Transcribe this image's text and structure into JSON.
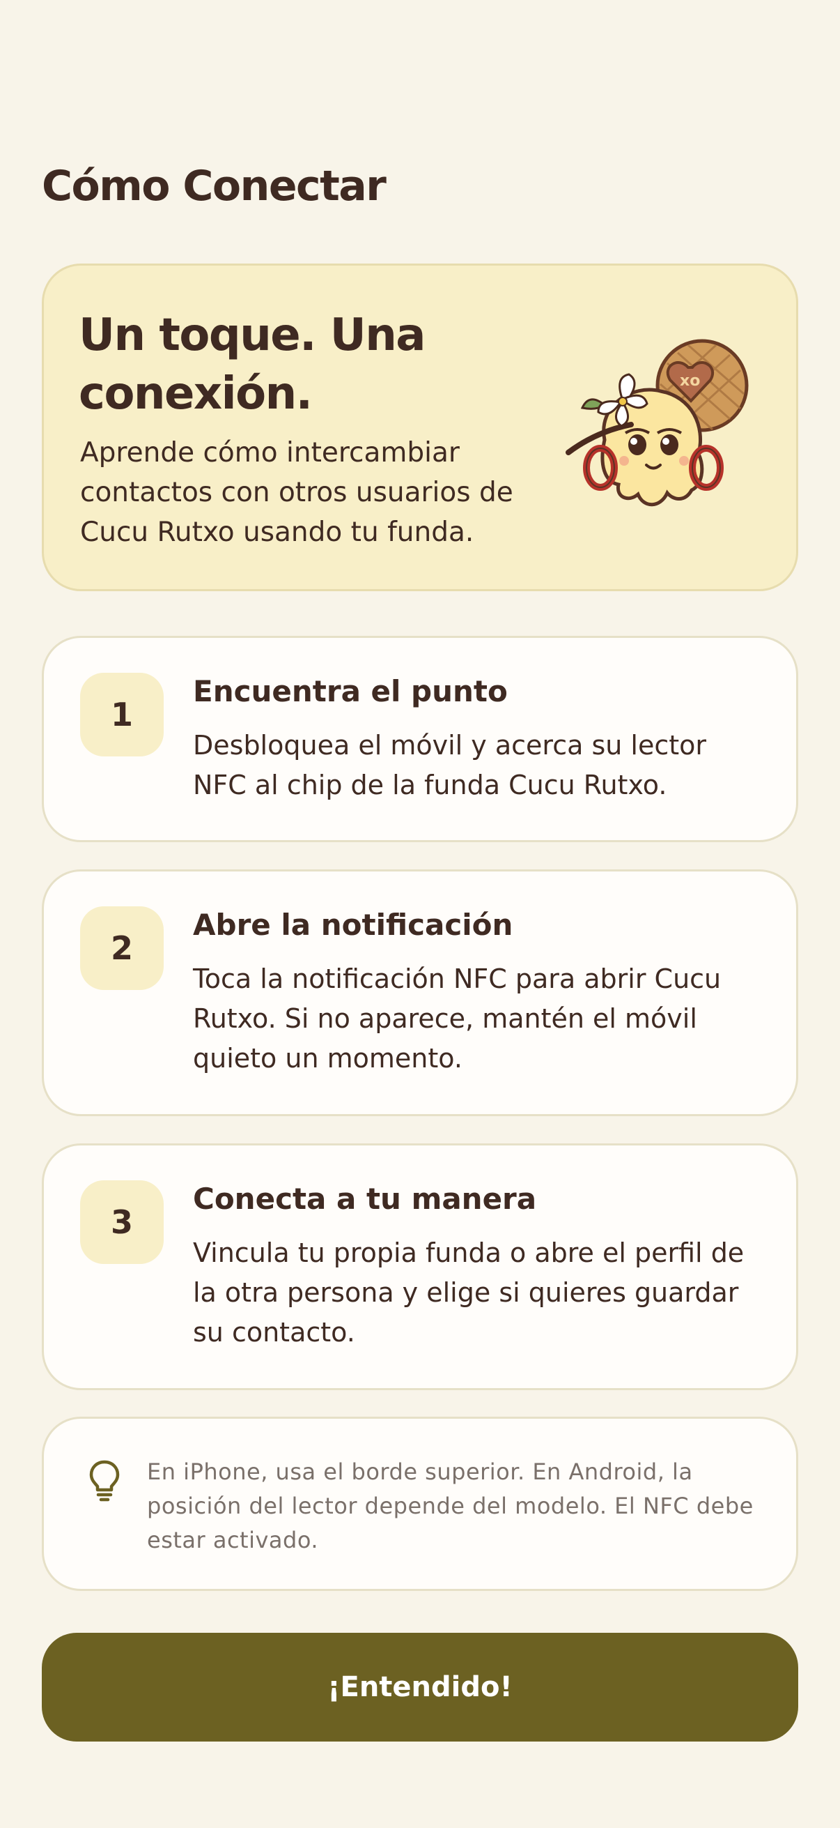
{
  "page": {
    "title": "Cómo Conectar"
  },
  "hero": {
    "title": "Un toque. Una conexión.",
    "description": "Aprende cómo intercambiar contactos con otros usuarios de Cucu Rutxo usando tu funda.",
    "illustration_icon": "mascot-illustration"
  },
  "steps": [
    {
      "number": "1",
      "title": "Encuentra el punto",
      "description": "Desbloquea el móvil y acerca su lector NFC al chip de la funda Cucu Rutxo."
    },
    {
      "number": "2",
      "title": "Abre la notificación",
      "description": "Toca la notificación NFC para abrir Cucu Rutxo. Si no aparece, mantén el móvil quieto un momento."
    },
    {
      "number": "3",
      "title": "Conecta a tu manera",
      "description": "Vincula tu propia funda o abre el perfil de la otra persona y elige si quieres guardar su contacto."
    }
  ],
  "tip": {
    "icon": "lightbulb-icon",
    "text": "En iPhone, usa el borde superior. En Android, la posición del lector depende del modelo. El NFC debe estar activado."
  },
  "cta": {
    "label": "¡Entendido!"
  },
  "colors": {
    "background": "#f8f4e9",
    "hero_background": "#f8efc8",
    "primary_text": "#3f2a22",
    "secondary_text": "#7a706a",
    "cta_background": "#6c6122",
    "card_background": "#fffdfa"
  }
}
